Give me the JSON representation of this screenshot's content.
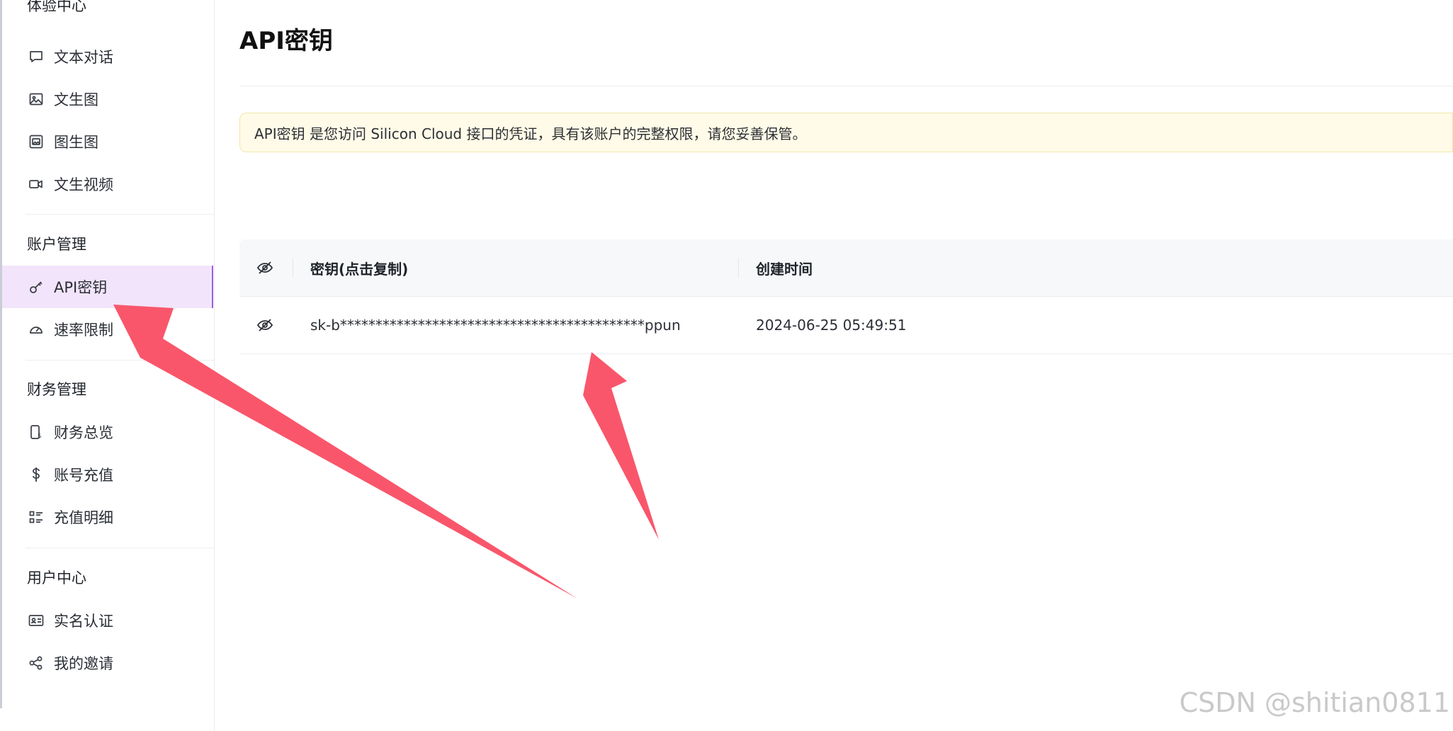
{
  "sidebar": {
    "groups": [
      {
        "title": "体验中心",
        "items": [
          {
            "label": "文本对话",
            "icon": "chat-bubble-icon"
          },
          {
            "label": "文生图",
            "icon": "image-icon"
          },
          {
            "label": "图生图",
            "icon": "images-icon"
          },
          {
            "label": "文生视频",
            "icon": "video-camera-icon"
          }
        ]
      },
      {
        "title": "账户管理",
        "items": [
          {
            "label": "API密钥",
            "icon": "key-icon",
            "active": true
          },
          {
            "label": "速率限制",
            "icon": "speedometer-icon"
          }
        ]
      },
      {
        "title": "财务管理",
        "items": [
          {
            "label": "财务总览",
            "icon": "billing-device-icon"
          },
          {
            "label": "账号充值",
            "icon": "dollar-icon"
          },
          {
            "label": "充值明细",
            "icon": "list-detail-icon"
          }
        ]
      },
      {
        "title": "用户中心",
        "items": [
          {
            "label": "实名认证",
            "icon": "id-card-icon"
          },
          {
            "label": "我的邀请",
            "icon": "share-icon"
          }
        ]
      }
    ]
  },
  "main": {
    "title": "API密钥",
    "notice": "API密钥 是您访问 Silicon Cloud 接口的凭证，具有该账户的完整权限，请您妥善保管。",
    "table": {
      "headers": {
        "visibility_icon": "eye-slash-icon",
        "key": "密钥(点击复制)",
        "created": "创建时间"
      },
      "rows": [
        {
          "visibility_icon": "eye-slash-icon",
          "key": "sk-b*******************************************ppun",
          "created": "2024-06-25 05:49:51"
        }
      ]
    }
  },
  "annotations": {
    "arrow_color": "#f9566b",
    "arrow_count": 2
  },
  "watermark": "CSDN @shitian0811",
  "colors": {
    "active_bg": "#f2e4fb",
    "active_border": "#9b5de5",
    "notice_bg": "#fffbe8",
    "notice_border": "#f3e6a8"
  }
}
